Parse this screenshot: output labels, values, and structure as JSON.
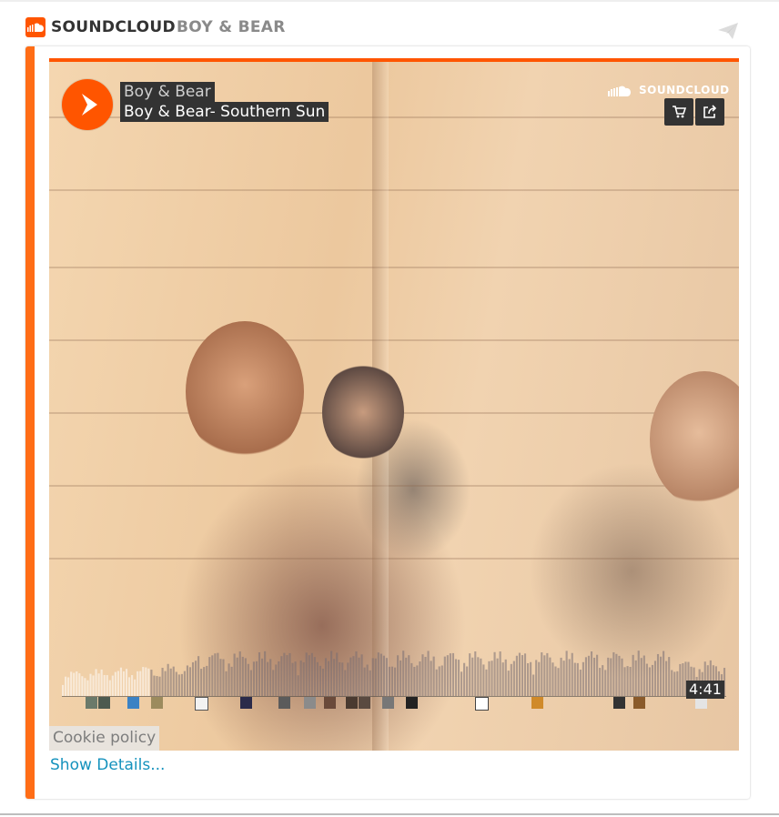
{
  "header": {
    "brand": "SOUNDCLOUD",
    "artist": "BOY & BEAR"
  },
  "player": {
    "artist": "Boy & Bear",
    "title": "Boy & Bear- Southern Sun",
    "wordmark": "SOUNDCLOUD",
    "duration": "4:41",
    "cookie_policy": "Cookie policy"
  },
  "footer": {
    "show_details": "Show Details..."
  },
  "colors": {
    "accent": "#ff5500",
    "card_accent": "#ff6d16",
    "link": "#1592bd",
    "overlay": "#333333"
  },
  "icons": [
    "soundcloud-logo-icon",
    "send-icon",
    "play-icon",
    "cart-icon",
    "share-icon"
  ]
}
